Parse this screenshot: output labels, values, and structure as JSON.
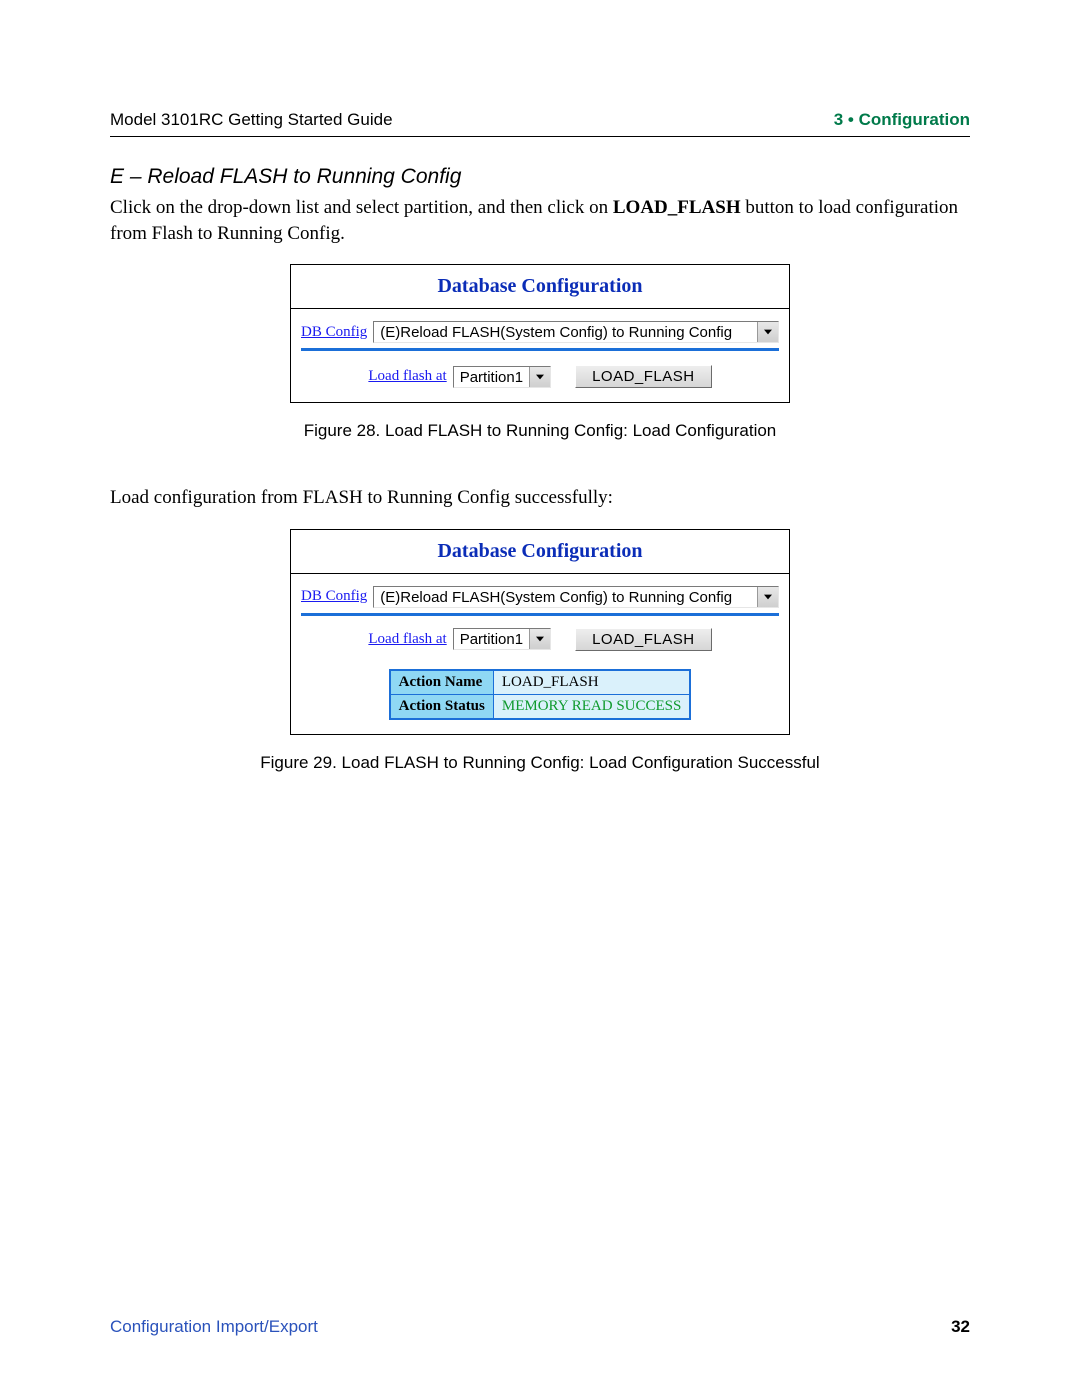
{
  "header": {
    "left": "Model 3101RC Getting Started Guide",
    "right": "3 • Configuration"
  },
  "section_title": "E – Reload FLASH to Running Config",
  "intro_prefix": "Click on the drop-down list and select partition, and then click on ",
  "intro_bold": "LOAD_FLASH",
  "intro_suffix": " button to load configuration from Flash to Running Config.",
  "panel1": {
    "title": "Database Configuration",
    "db_config_label": "DB Config",
    "db_config_value": "(E)Reload FLASH(System Config) to Running Config",
    "load_at_label": "Load flash at",
    "load_at_value": "Partition1",
    "button": "LOAD_FLASH"
  },
  "caption1": "Figure 28. Load FLASH to Running Config: Load Configuration",
  "midline": "Load configuration from FLASH to Running Config successfully:",
  "panel2": {
    "title": "Database Configuration",
    "db_config_label": "DB Config",
    "db_config_value": "(E)Reload FLASH(System Config) to Running Config",
    "load_at_label": "Load flash at",
    "load_at_value": "Partition1",
    "button": "LOAD_FLASH",
    "action_name_label": "Action Name",
    "action_name_value": "LOAD_FLASH",
    "action_status_label": "Action Status",
    "action_status_value": "MEMORY READ SUCCESS"
  },
  "caption2": "Figure 29. Load FLASH to Running Config: Load Configuration Successful",
  "footer": {
    "left": "Configuration Import/Export",
    "page": "32"
  }
}
